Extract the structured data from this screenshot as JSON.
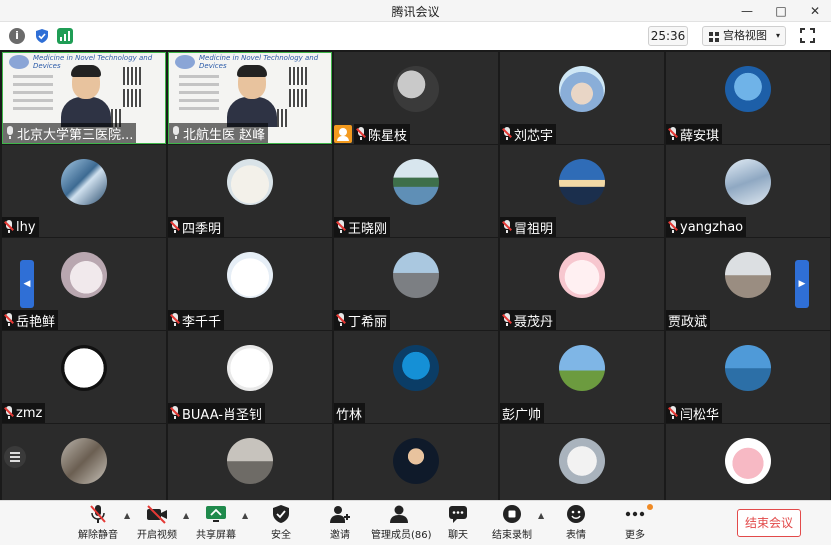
{
  "window": {
    "title": "腾讯会议",
    "minimize": "—",
    "maximize": "□",
    "close": "✕"
  },
  "toolbar": {
    "timer": "25:36",
    "view_mode": "宫格视图",
    "view_caret": "▾"
  },
  "participants": [
    {
      "name": "北京大学第三医院...",
      "mic": "on",
      "avatar": "video"
    },
    {
      "name": "北航生医 赵峰",
      "mic": "on",
      "avatar": "video"
    },
    {
      "name": "陈星枝",
      "mic": "muted",
      "hand": true,
      "avatar": "photo-street"
    },
    {
      "name": "刘芯宇",
      "mic": "muted",
      "avatar": "photo-anime"
    },
    {
      "name": "薛安琪",
      "mic": "muted",
      "avatar": "photo-sky"
    },
    {
      "name": "lhy",
      "mic": "muted",
      "avatar": "photo-building"
    },
    {
      "name": "四季明",
      "mic": "muted",
      "avatar": "cartoon-face"
    },
    {
      "name": "王晓刚",
      "mic": "muted",
      "avatar": "photo-lake"
    },
    {
      "name": "冒祖明",
      "mic": "muted",
      "avatar": "photo-mountain"
    },
    {
      "name": "yangzhao",
      "mic": "muted",
      "avatar": "photo-snow"
    },
    {
      "name": "岳艳鲜",
      "mic": "muted",
      "avatar": "photo-cat"
    },
    {
      "name": "李千千",
      "mic": "muted",
      "avatar": "cartoon-girl"
    },
    {
      "name": "丁希丽",
      "mic": "muted",
      "avatar": "photo-road"
    },
    {
      "name": "聂茂丹",
      "mic": "muted",
      "avatar": "cartoon-pink"
    },
    {
      "name": "贾政斌",
      "mic": "none",
      "avatar": "photo-birds"
    },
    {
      "name": "zmz",
      "mic": "muted",
      "avatar": "calligraphy"
    },
    {
      "name": "BUAA-肖圣钊",
      "mic": "muted",
      "avatar": "cartoon-glasses"
    },
    {
      "name": "竹林",
      "mic": "none",
      "avatar": "photo-blue"
    },
    {
      "name": "彭广帅",
      "mic": "none",
      "avatar": "photo-windmill"
    },
    {
      "name": "闫松华",
      "mic": "muted",
      "avatar": "photo-sea"
    },
    {
      "name": "",
      "mic": "none",
      "avatar": "photo-wood"
    },
    {
      "name": "",
      "mic": "none",
      "avatar": "photo-crowd"
    },
    {
      "name": "",
      "mic": "none",
      "avatar": "photo-art"
    },
    {
      "name": "",
      "mic": "none",
      "avatar": "anime-silver"
    },
    {
      "name": "",
      "mic": "none",
      "avatar": "cartoon-pig"
    }
  ],
  "poster": {
    "title": "Medicine in Novel Technology and Devices"
  },
  "bottombar": {
    "unmute": "解除静音",
    "start_video": "开启视频",
    "share_screen": "共享屏幕",
    "security": "安全",
    "invite": "邀请",
    "manage_members": "管理成员(86)",
    "chat": "聊天",
    "end_recording": "结束录制",
    "reactions": "表情",
    "more": "更多",
    "end_meeting": "结束会议"
  },
  "colors": {
    "accent": "#2f6fd6",
    "hand": "#f39a1e",
    "end": "#e24a4a",
    "active": "#3fb54a"
  }
}
